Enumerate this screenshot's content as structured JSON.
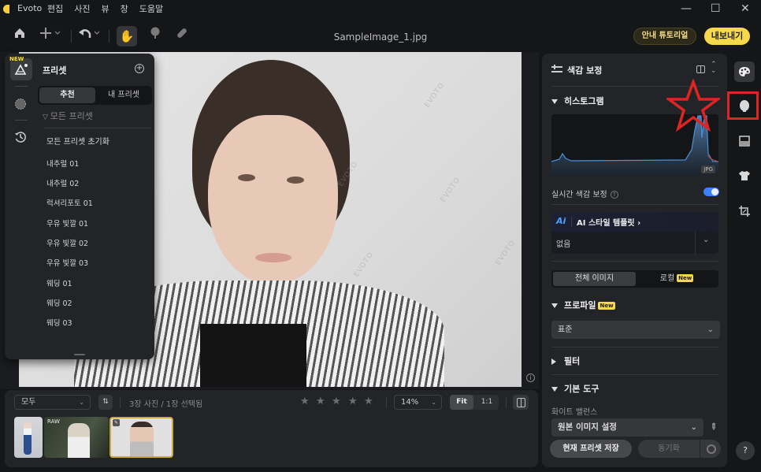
{
  "app": {
    "name": "Evoto",
    "menu": [
      "편집",
      "사진",
      "뷰",
      "창",
      "도움말"
    ],
    "window_controls": {
      "minimize": "—",
      "maximize": "☐",
      "close": "✕"
    }
  },
  "toolbar": {
    "file_title": "SampleImage_1.jpg",
    "tutorial_label": "안내 튜토리얼",
    "export_label": "내보내기",
    "icons": [
      "home-icon",
      "add-icon",
      "undo-icon",
      "hand-icon",
      "tree-icon",
      "bandage-icon"
    ]
  },
  "preset_panel": {
    "new_tag": "NEW",
    "title": "프리셋",
    "tabs": [
      "추천",
      "내 프리셋"
    ],
    "active_tab": "추천",
    "filter_label": "모든 프리셋",
    "reset_label": "모든 프리셋 초기화",
    "items": [
      "내추럴 01",
      "내추럴 02",
      "럭셔리포토 01",
      "우유 빛깔 01",
      "우유 빛깔 02",
      "우유 빛깔 03",
      "웨딩 01",
      "웨딩 02",
      "웨딩 03"
    ]
  },
  "canvas": {
    "watermark": "EVOTO",
    "info_icon": "i"
  },
  "filmstrip": {
    "filter_value": "모두",
    "sort_label": "⇅",
    "count_text": "3장 사진 / 1장 선택됨",
    "rating_stars": 5,
    "rating_value": 0,
    "zoom_value": "14%",
    "fit_label": "Fit",
    "one_to_one_label": "1:1",
    "thumbnails": [
      {
        "badge": "",
        "selected": false
      },
      {
        "badge": "RAW",
        "selected": false
      },
      {
        "badge": "✎",
        "selected": true
      }
    ]
  },
  "right_panel": {
    "title": "색감 보정",
    "histogram": {
      "title": "히스토그램",
      "format_badge": "JPG"
    },
    "realtime_label": "실시간 색감 보정",
    "realtime_enabled": true,
    "ai_template": {
      "logo": "Ai",
      "label": "AI 스타일 템플릿 ›",
      "value": "없음"
    },
    "scope_tabs": {
      "a": "전체 이미지",
      "b": "로컬",
      "b_badge": "New"
    },
    "profile": {
      "title": "프로파일",
      "badge": "New",
      "value": "표준"
    },
    "filter_title": "필터",
    "basic_tools_title": "기본 도구",
    "white_balance": {
      "label": "화이트 밸런스",
      "value": "원본 이미지 설정"
    },
    "save_preset_label": "현재 프리셋 저장",
    "sync_label": "동기화"
  },
  "tool_strip": {
    "icons": [
      "palette-icon",
      "face-icon",
      "background-icon",
      "clothing-icon",
      "crop-icon"
    ],
    "help_label": "?"
  },
  "colors": {
    "accent_yellow": "#f6d94b",
    "toggle_blue": "#3b82f6",
    "annotation_red": "#e02424"
  }
}
